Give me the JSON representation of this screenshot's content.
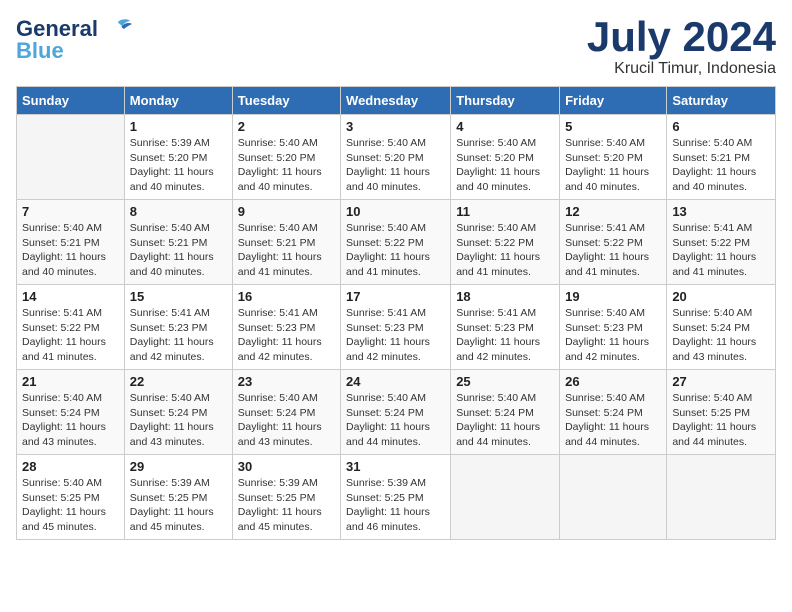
{
  "header": {
    "logo_general": "General",
    "logo_blue": "Blue",
    "month_title": "July 2024",
    "location": "Krucil Timur, Indonesia"
  },
  "columns": [
    "Sunday",
    "Monday",
    "Tuesday",
    "Wednesday",
    "Thursday",
    "Friday",
    "Saturday"
  ],
  "weeks": [
    [
      {
        "day": "",
        "empty": true
      },
      {
        "day": "1",
        "sunrise": "Sunrise: 5:39 AM",
        "sunset": "Sunset: 5:20 PM",
        "daylight": "Daylight: 11 hours and 40 minutes."
      },
      {
        "day": "2",
        "sunrise": "Sunrise: 5:40 AM",
        "sunset": "Sunset: 5:20 PM",
        "daylight": "Daylight: 11 hours and 40 minutes."
      },
      {
        "day": "3",
        "sunrise": "Sunrise: 5:40 AM",
        "sunset": "Sunset: 5:20 PM",
        "daylight": "Daylight: 11 hours and 40 minutes."
      },
      {
        "day": "4",
        "sunrise": "Sunrise: 5:40 AM",
        "sunset": "Sunset: 5:20 PM",
        "daylight": "Daylight: 11 hours and 40 minutes."
      },
      {
        "day": "5",
        "sunrise": "Sunrise: 5:40 AM",
        "sunset": "Sunset: 5:20 PM",
        "daylight": "Daylight: 11 hours and 40 minutes."
      },
      {
        "day": "6",
        "sunrise": "Sunrise: 5:40 AM",
        "sunset": "Sunset: 5:21 PM",
        "daylight": "Daylight: 11 hours and 40 minutes."
      }
    ],
    [
      {
        "day": "7",
        "sunrise": "Sunrise: 5:40 AM",
        "sunset": "Sunset: 5:21 PM",
        "daylight": "Daylight: 11 hours and 40 minutes."
      },
      {
        "day": "8",
        "sunrise": "Sunrise: 5:40 AM",
        "sunset": "Sunset: 5:21 PM",
        "daylight": "Daylight: 11 hours and 40 minutes."
      },
      {
        "day": "9",
        "sunrise": "Sunrise: 5:40 AM",
        "sunset": "Sunset: 5:21 PM",
        "daylight": "Daylight: 11 hours and 41 minutes."
      },
      {
        "day": "10",
        "sunrise": "Sunrise: 5:40 AM",
        "sunset": "Sunset: 5:22 PM",
        "daylight": "Daylight: 11 hours and 41 minutes."
      },
      {
        "day": "11",
        "sunrise": "Sunrise: 5:40 AM",
        "sunset": "Sunset: 5:22 PM",
        "daylight": "Daylight: 11 hours and 41 minutes."
      },
      {
        "day": "12",
        "sunrise": "Sunrise: 5:41 AM",
        "sunset": "Sunset: 5:22 PM",
        "daylight": "Daylight: 11 hours and 41 minutes."
      },
      {
        "day": "13",
        "sunrise": "Sunrise: 5:41 AM",
        "sunset": "Sunset: 5:22 PM",
        "daylight": "Daylight: 11 hours and 41 minutes."
      }
    ],
    [
      {
        "day": "14",
        "sunrise": "Sunrise: 5:41 AM",
        "sunset": "Sunset: 5:22 PM",
        "daylight": "Daylight: 11 hours and 41 minutes."
      },
      {
        "day": "15",
        "sunrise": "Sunrise: 5:41 AM",
        "sunset": "Sunset: 5:23 PM",
        "daylight": "Daylight: 11 hours and 42 minutes."
      },
      {
        "day": "16",
        "sunrise": "Sunrise: 5:41 AM",
        "sunset": "Sunset: 5:23 PM",
        "daylight": "Daylight: 11 hours and 42 minutes."
      },
      {
        "day": "17",
        "sunrise": "Sunrise: 5:41 AM",
        "sunset": "Sunset: 5:23 PM",
        "daylight": "Daylight: 11 hours and 42 minutes."
      },
      {
        "day": "18",
        "sunrise": "Sunrise: 5:41 AM",
        "sunset": "Sunset: 5:23 PM",
        "daylight": "Daylight: 11 hours and 42 minutes."
      },
      {
        "day": "19",
        "sunrise": "Sunrise: 5:40 AM",
        "sunset": "Sunset: 5:23 PM",
        "daylight": "Daylight: 11 hours and 42 minutes."
      },
      {
        "day": "20",
        "sunrise": "Sunrise: 5:40 AM",
        "sunset": "Sunset: 5:24 PM",
        "daylight": "Daylight: 11 hours and 43 minutes."
      }
    ],
    [
      {
        "day": "21",
        "sunrise": "Sunrise: 5:40 AM",
        "sunset": "Sunset: 5:24 PM",
        "daylight": "Daylight: 11 hours and 43 minutes."
      },
      {
        "day": "22",
        "sunrise": "Sunrise: 5:40 AM",
        "sunset": "Sunset: 5:24 PM",
        "daylight": "Daylight: 11 hours and 43 minutes."
      },
      {
        "day": "23",
        "sunrise": "Sunrise: 5:40 AM",
        "sunset": "Sunset: 5:24 PM",
        "daylight": "Daylight: 11 hours and 43 minutes."
      },
      {
        "day": "24",
        "sunrise": "Sunrise: 5:40 AM",
        "sunset": "Sunset: 5:24 PM",
        "daylight": "Daylight: 11 hours and 44 minutes."
      },
      {
        "day": "25",
        "sunrise": "Sunrise: 5:40 AM",
        "sunset": "Sunset: 5:24 PM",
        "daylight": "Daylight: 11 hours and 44 minutes."
      },
      {
        "day": "26",
        "sunrise": "Sunrise: 5:40 AM",
        "sunset": "Sunset: 5:24 PM",
        "daylight": "Daylight: 11 hours and 44 minutes."
      },
      {
        "day": "27",
        "sunrise": "Sunrise: 5:40 AM",
        "sunset": "Sunset: 5:25 PM",
        "daylight": "Daylight: 11 hours and 44 minutes."
      }
    ],
    [
      {
        "day": "28",
        "sunrise": "Sunrise: 5:40 AM",
        "sunset": "Sunset: 5:25 PM",
        "daylight": "Daylight: 11 hours and 45 minutes."
      },
      {
        "day": "29",
        "sunrise": "Sunrise: 5:39 AM",
        "sunset": "Sunset: 5:25 PM",
        "daylight": "Daylight: 11 hours and 45 minutes."
      },
      {
        "day": "30",
        "sunrise": "Sunrise: 5:39 AM",
        "sunset": "Sunset: 5:25 PM",
        "daylight": "Daylight: 11 hours and 45 minutes."
      },
      {
        "day": "31",
        "sunrise": "Sunrise: 5:39 AM",
        "sunset": "Sunset: 5:25 PM",
        "daylight": "Daylight: 11 hours and 46 minutes."
      },
      {
        "day": "",
        "empty": true
      },
      {
        "day": "",
        "empty": true
      },
      {
        "day": "",
        "empty": true
      }
    ]
  ]
}
